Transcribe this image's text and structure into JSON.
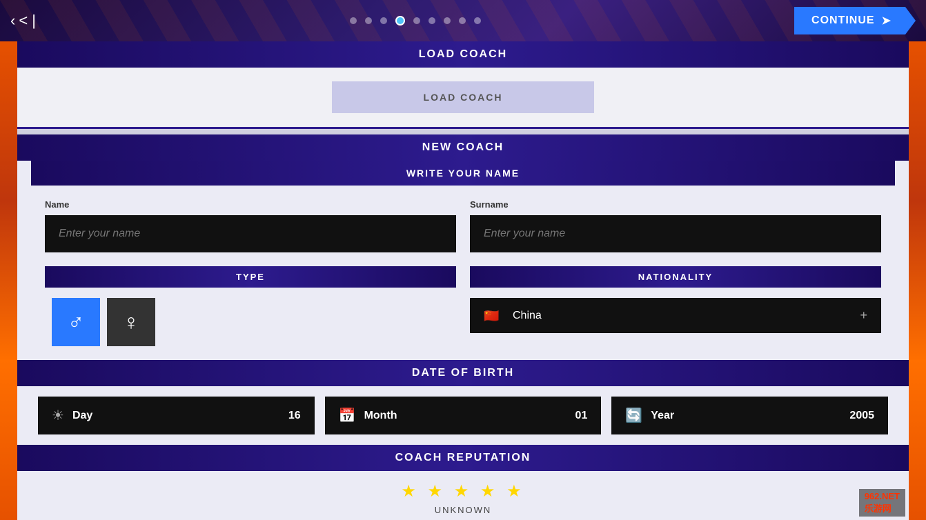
{
  "topbar": {
    "back_label": "< |",
    "continue_label": "CONTINUE",
    "dots": [
      {
        "id": 1,
        "active": false
      },
      {
        "id": 2,
        "active": false
      },
      {
        "id": 3,
        "active": false
      },
      {
        "id": 4,
        "active": true
      },
      {
        "id": 5,
        "active": false
      },
      {
        "id": 6,
        "active": false
      },
      {
        "id": 7,
        "active": false
      },
      {
        "id": 8,
        "active": false
      },
      {
        "id": 9,
        "active": false
      }
    ]
  },
  "load_coach": {
    "section_title": "LOAD COACH",
    "button_label": "LOAD COACH"
  },
  "new_coach": {
    "section_title": "NEW COACH",
    "write_name": {
      "header": "WRITE YOUR NAME",
      "name_label": "Name",
      "name_placeholder": "Enter your name",
      "surname_label": "Surname",
      "surname_placeholder": "Enter your name"
    },
    "type": {
      "header": "TYPE",
      "male_symbol": "♂",
      "female_symbol": "♀"
    },
    "nationality": {
      "header": "NATIONALITY",
      "country": "China",
      "flag": "🇨🇳",
      "plus": "+"
    },
    "date_of_birth": {
      "header": "DATE OF BIRTH",
      "day_label": "Day",
      "day_value": "16",
      "month_label": "Month",
      "month_value": "01",
      "year_label": "Year",
      "year_value": "2005"
    },
    "reputation": {
      "header": "COACH REPUTATION",
      "stars": "★ ★ ★ ★ ★",
      "label": "UNKNOWN"
    }
  },
  "watermark": {
    "text": "962.NET",
    "sub": "乐游网"
  }
}
